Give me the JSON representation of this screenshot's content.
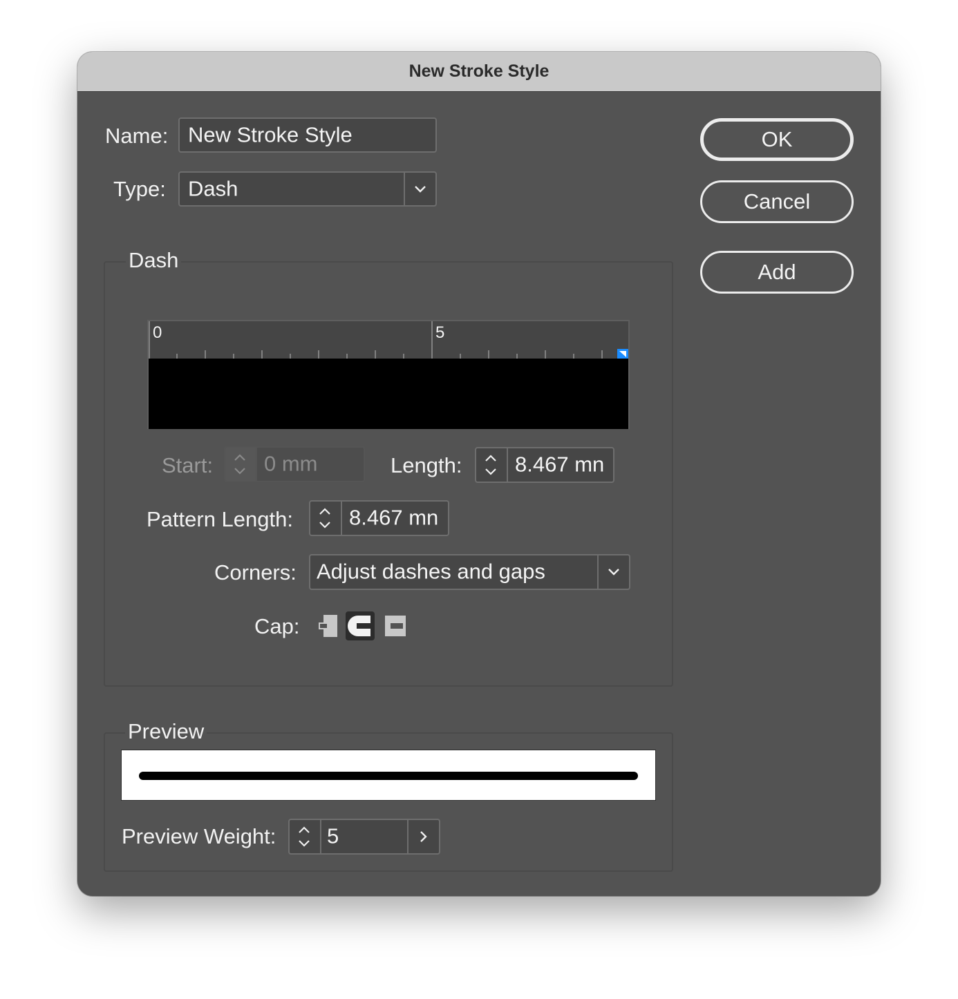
{
  "window": {
    "title": "New Stroke Style"
  },
  "name_field": {
    "label": "Name:",
    "value": "New Stroke Style"
  },
  "type_field": {
    "label": "Type:",
    "value": "Dash"
  },
  "dash_group": {
    "title": "Dash",
    "ruler_labels": [
      "0",
      "5"
    ],
    "start": {
      "label": "Start:",
      "value": "0 mm"
    },
    "length": {
      "label": "Length:",
      "value": "8.467 mn"
    },
    "pattern_length": {
      "label": "Pattern Length:",
      "value": "8.467 mn"
    },
    "corners": {
      "label": "Corners:",
      "value": "Adjust dashes and gaps"
    },
    "cap": {
      "label": "Cap:",
      "selected": "round-cap"
    }
  },
  "preview_group": {
    "title": "Preview",
    "weight": {
      "label": "Preview Weight:",
      "value": "5"
    }
  },
  "buttons": {
    "ok": "OK",
    "cancel": "Cancel",
    "add": "Add"
  },
  "colors": {
    "dialog_bg": "#535353",
    "titlebar_bg": "#c9c9c9",
    "marker_blue": "#1a8cff"
  }
}
